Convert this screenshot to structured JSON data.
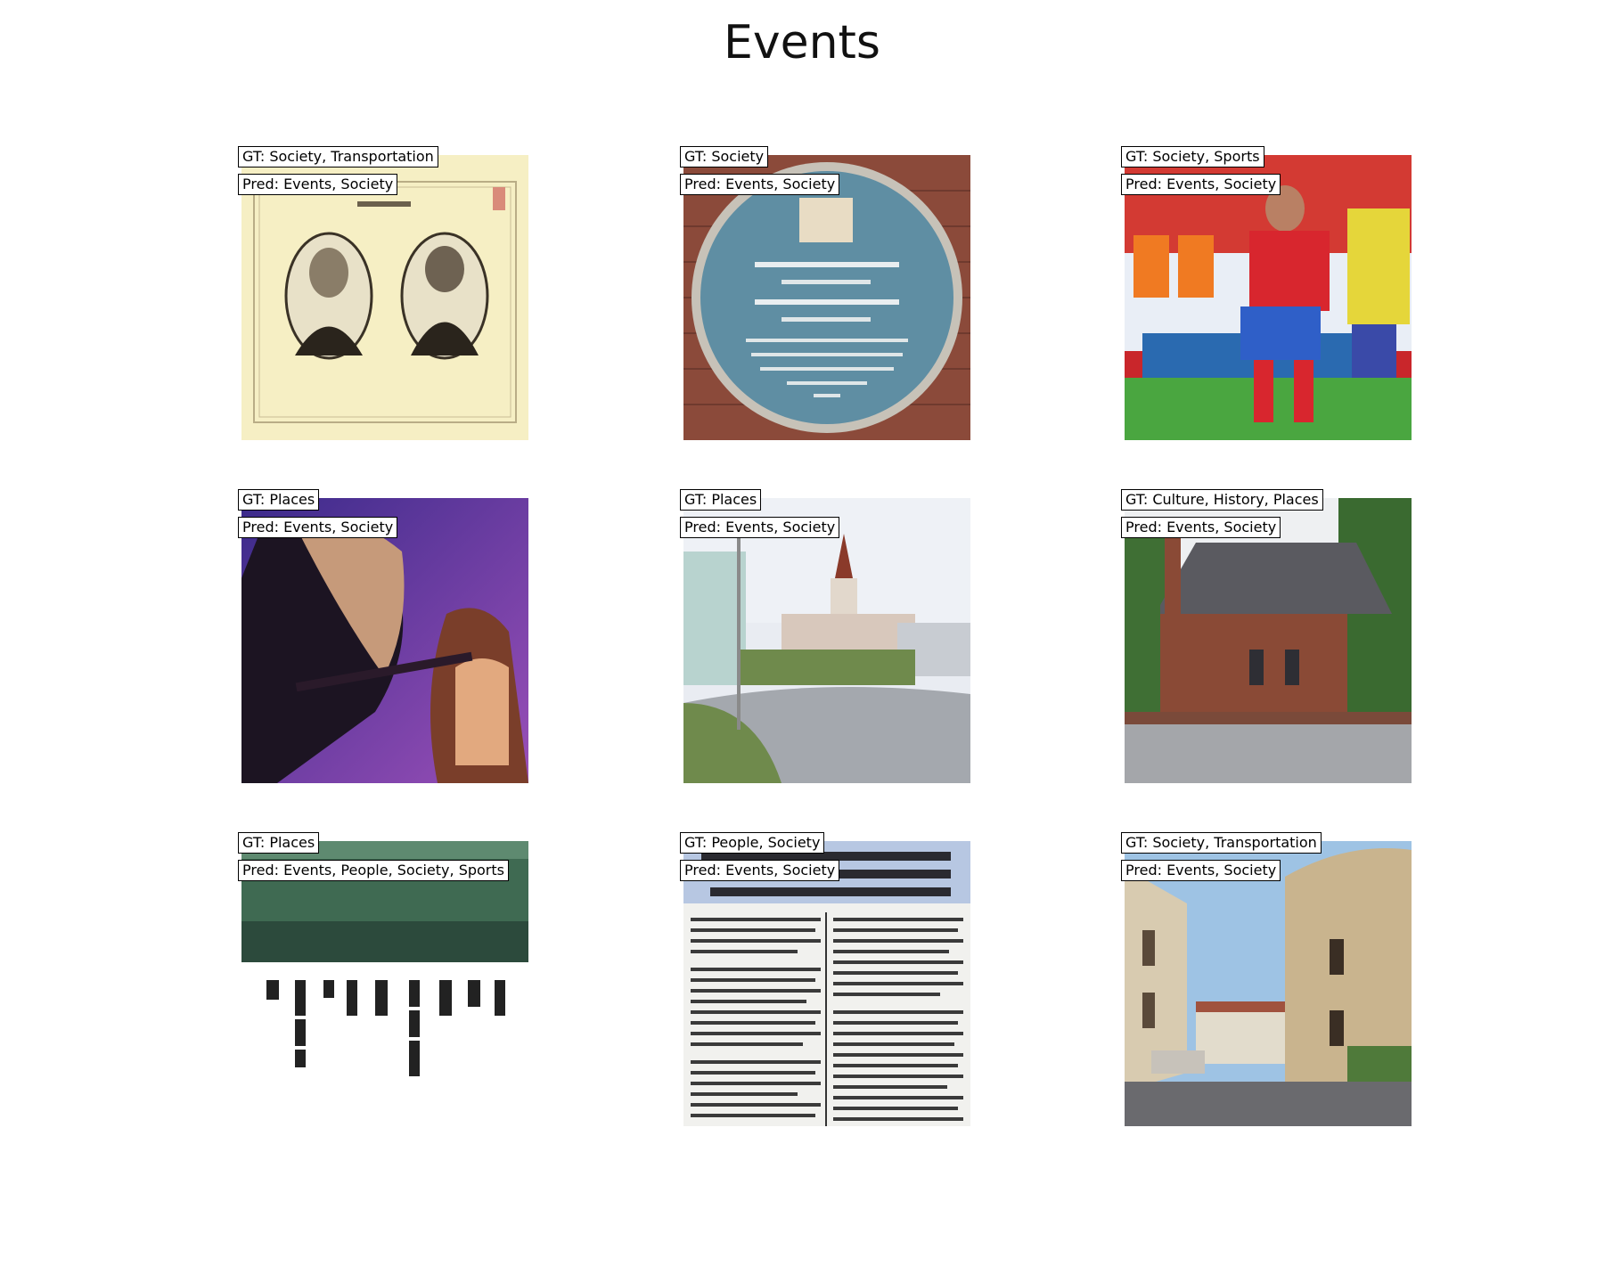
{
  "figure": {
    "title": "Events"
  },
  "panels": [
    {
      "gt": "GT: Society, Transportation",
      "pred": "Pred: Events, Society",
      "image_subject": "founders-portrait-card"
    },
    {
      "gt": "GT: Society",
      "pred": "Pred: Events, Society",
      "image_subject": "blue-memorial-plaque"
    },
    {
      "gt": "GT: Society, Sports",
      "pred": "Pred: Events, Society",
      "image_subject": "football-players"
    },
    {
      "gt": "GT: Places",
      "pred": "Pred: Events, Society",
      "image_subject": "metal-concert"
    },
    {
      "gt": "GT: Places",
      "pred": "Pred: Events, Society",
      "image_subject": "town-street-church"
    },
    {
      "gt": "GT: Culture, History, Places",
      "pred": "Pred: Events, Society",
      "image_subject": "brick-church"
    },
    {
      "gt": "GT: Places",
      "pred": "Pred: Events, People, Society, Sports",
      "image_subject": "tablet-and-glyphs"
    },
    {
      "gt": "GT: People, Society",
      "pred": "Pred: Events, Society",
      "image_subject": "newspaper-clipping"
    },
    {
      "gt": "GT: Society, Transportation",
      "pred": "Pred: Events, Society",
      "image_subject": "old-street-buildings"
    }
  ]
}
